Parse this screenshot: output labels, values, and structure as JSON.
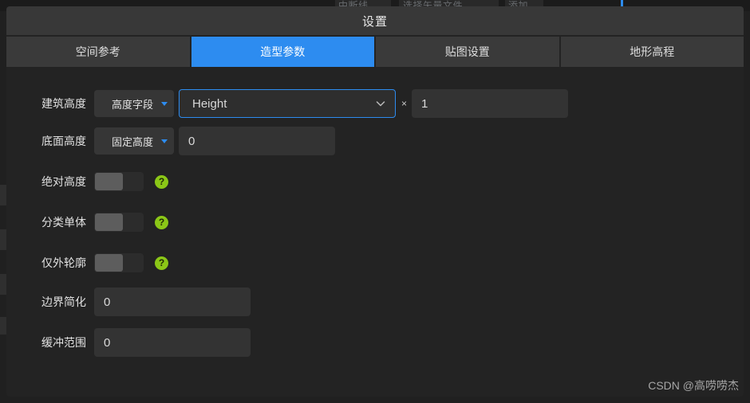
{
  "background": {
    "ghost_text_left": "中断线",
    "ghost_text_mid": "选择矢量文件",
    "ghost_text_right": "添加"
  },
  "panel": {
    "title": "设置",
    "tabs": [
      {
        "label": "空间参考",
        "active": false
      },
      {
        "label": "造型参数",
        "active": true
      },
      {
        "label": "贴图设置",
        "active": false
      },
      {
        "label": "地形高程",
        "active": false
      }
    ]
  },
  "form": {
    "building_height": {
      "label": "建筑高度",
      "mode_button": "高度字段",
      "field_value": "Height",
      "multiply_symbol": "×",
      "multiplier_value": "1"
    },
    "base_height": {
      "label": "底面高度",
      "mode_button": "固定高度",
      "value": "0"
    },
    "absolute_height": {
      "label": "绝对高度",
      "enabled": false,
      "help": "?"
    },
    "classified_single": {
      "label": "分类单体",
      "enabled": false,
      "help": "?"
    },
    "outline_only": {
      "label": "仅外轮廓",
      "enabled": false,
      "help": "?"
    },
    "boundary_simplify": {
      "label": "边界简化",
      "value": "0"
    },
    "buffer_range": {
      "label": "缓冲范围",
      "value": "0"
    }
  },
  "watermark": "CSDN @高唠唠杰",
  "colors": {
    "accent": "#2d8cf0",
    "help_green": "#8bc717",
    "panel_bg": "#232323",
    "header_bg": "#383838"
  }
}
